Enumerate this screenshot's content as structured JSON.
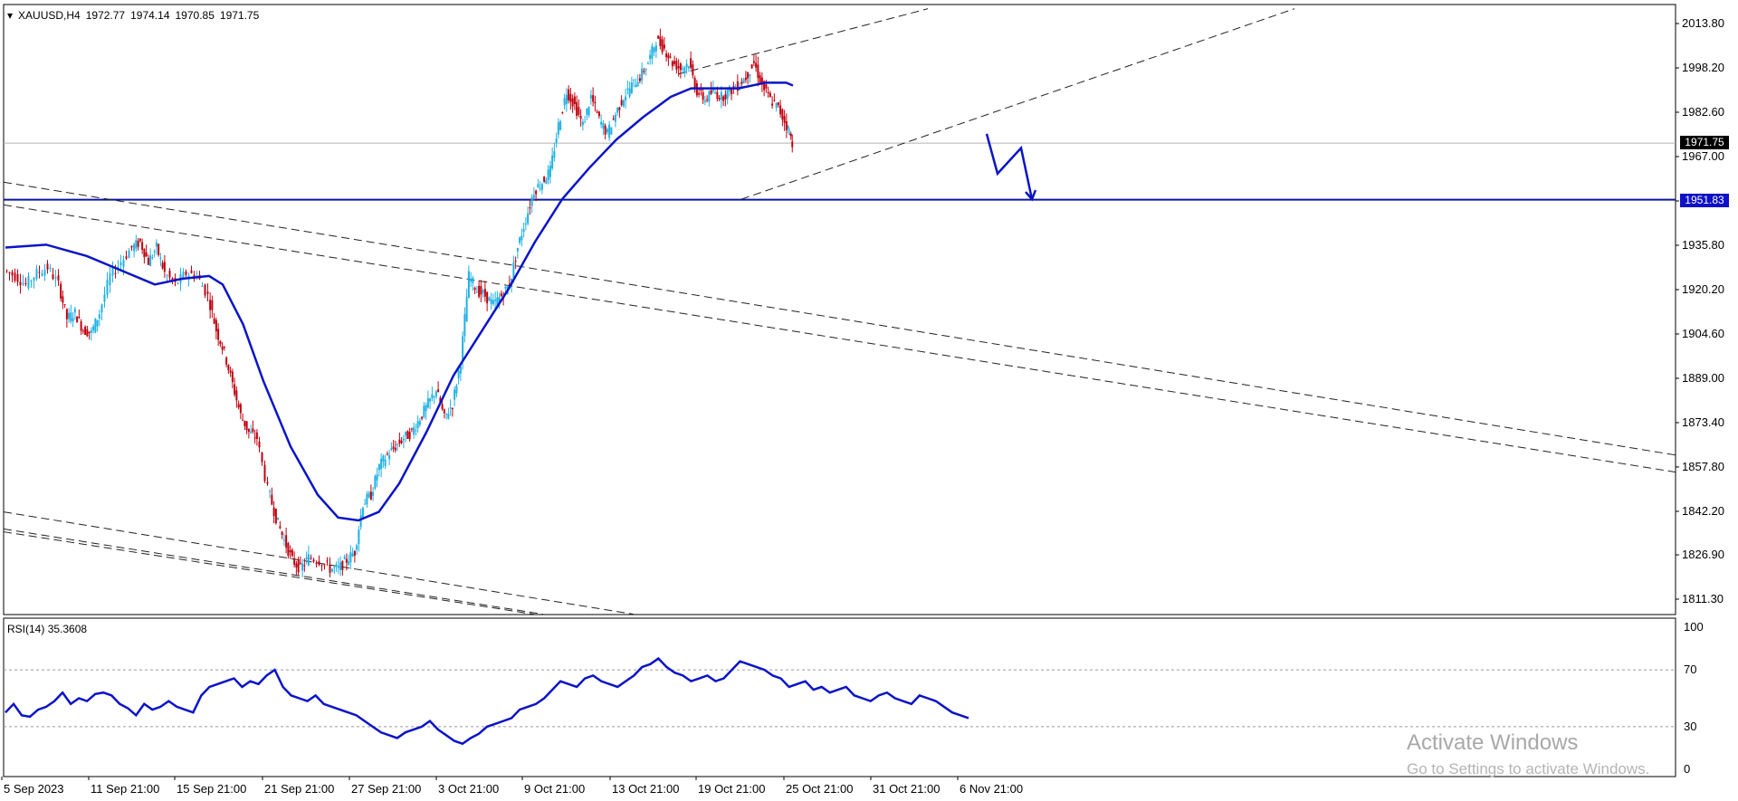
{
  "symbol_header": {
    "symbol": "XAUUSD,H4",
    "open": "1972.77",
    "high": "1974.14",
    "low": "1970.85",
    "close": "1971.75"
  },
  "rsi_header": {
    "name": "RSI(14)",
    "value": "35.3608"
  },
  "price_tags": {
    "last": "1971.75",
    "level": "1951.83"
  },
  "watermark": {
    "line1": "Activate Windows",
    "line2": "Go to Settings to activate Windows."
  },
  "colors": {
    "bull": "#1fb1e3",
    "bear": "#c0000f",
    "ma": "#0a14c8",
    "rsi": "#0a14c8",
    "level": "#0a14a0"
  },
  "chart_data": [
    {
      "type": "candlestick",
      "title": "XAUUSD,H4",
      "y_ticks": [
        2013.8,
        1998.2,
        1982.6,
        1967.0,
        1951.4,
        1935.8,
        1920.2,
        1904.6,
        1889.0,
        1873.4,
        1857.8,
        1842.2,
        1826.9,
        1811.3
      ],
      "y_tick_labels": [
        "2013.80",
        "1998.20",
        "1982.60",
        "1967.00",
        "1951.40",
        "1935.80",
        "1920.20",
        "1904.60",
        "1889.00",
        "1873.40",
        "1857.80",
        "1842.20",
        "1826.90",
        "1811.30"
      ],
      "x_tick_labels": [
        "5 Sep 2023",
        "11 Sep 21:00",
        "15 Sep 21:00",
        "21 Sep 21:00",
        "27 Sep 21:00",
        "3 Oct 21:00",
        "9 Oct 21:00",
        "13 Oct 21:00",
        "19 Oct 21:00",
        "25 Oct 21:00",
        "31 Oct 21:00",
        "6 Nov 21:00"
      ],
      "ylim": [
        1806,
        2019
      ],
      "last_price": 1971.75,
      "horizontal_level": 1951.83,
      "close_path": [
        [
          0,
          1927
        ],
        [
          8,
          1925
        ],
        [
          16,
          1922
        ],
        [
          24,
          1926
        ],
        [
          32,
          1928
        ],
        [
          40,
          1922
        ],
        [
          46,
          1910
        ],
        [
          52,
          1912
        ],
        [
          58,
          1906
        ],
        [
          64,
          1905
        ],
        [
          70,
          1912
        ],
        [
          78,
          1925
        ],
        [
          86,
          1930
        ],
        [
          94,
          1935
        ],
        [
          100,
          1937
        ],
        [
          106,
          1930
        ],
        [
          112,
          1935
        ],
        [
          118,
          1926
        ],
        [
          126,
          1922
        ],
        [
          134,
          1926
        ],
        [
          142,
          1925
        ],
        [
          150,
          1918
        ],
        [
          156,
          1906
        ],
        [
          162,
          1898
        ],
        [
          168,
          1887
        ],
        [
          174,
          1876
        ],
        [
          180,
          1870
        ],
        [
          186,
          1868
        ],
        [
          194,
          1850
        ],
        [
          200,
          1840
        ],
        [
          206,
          1832
        ],
        [
          212,
          1825
        ],
        [
          218,
          1822
        ],
        [
          224,
          1826
        ],
        [
          232,
          1825
        ],
        [
          240,
          1822
        ],
        [
          246,
          1822
        ],
        [
          252,
          1825
        ],
        [
          258,
          1828
        ],
        [
          264,
          1845
        ],
        [
          270,
          1848
        ],
        [
          276,
          1858
        ],
        [
          282,
          1862
        ],
        [
          288,
          1865
        ],
        [
          294,
          1868
        ],
        [
          300,
          1870
        ],
        [
          306,
          1875
        ],
        [
          312,
          1880
        ],
        [
          318,
          1885
        ],
        [
          324,
          1875
        ],
        [
          330,
          1880
        ],
        [
          336,
          1895
        ],
        [
          342,
          1925
        ],
        [
          348,
          1920
        ],
        [
          354,
          1918
        ],
        [
          360,
          1915
        ],
        [
          366,
          1918
        ],
        [
          372,
          1922
        ],
        [
          378,
          1935
        ],
        [
          384,
          1945
        ],
        [
          390,
          1955
        ],
        [
          396,
          1958
        ],
        [
          402,
          1962
        ],
        [
          408,
          1978
        ],
        [
          414,
          1990
        ],
        [
          420,
          1985
        ],
        [
          426,
          1978
        ],
        [
          432,
          1988
        ],
        [
          438,
          1980
        ],
        [
          444,
          1975
        ],
        [
          450,
          1982
        ],
        [
          456,
          1988
        ],
        [
          462,
          1992
        ],
        [
          468,
          1995
        ],
        [
          474,
          2000
        ],
        [
          480,
          2008
        ],
        [
          486,
          2005
        ],
        [
          492,
          2000
        ],
        [
          498,
          1998
        ],
        [
          504,
          2000
        ],
        [
          510,
          1990
        ],
        [
          516,
          1987
        ],
        [
          522,
          1990
        ],
        [
          528,
          1988
        ],
        [
          534,
          1990
        ],
        [
          540,
          1992
        ],
        [
          546,
          1995
        ],
        [
          552,
          2000
        ],
        [
          558,
          1992
        ],
        [
          564,
          1987
        ],
        [
          570,
          1984
        ],
        [
          576,
          1978
        ],
        [
          580,
          1972
        ]
      ],
      "moving_average": [
        [
          0,
          1935
        ],
        [
          30,
          1936
        ],
        [
          60,
          1932
        ],
        [
          90,
          1926
        ],
        [
          110,
          1922
        ],
        [
          130,
          1924
        ],
        [
          150,
          1925
        ],
        [
          160,
          1922
        ],
        [
          175,
          1908
        ],
        [
          190,
          1888
        ],
        [
          210,
          1865
        ],
        [
          230,
          1848
        ],
        [
          245,
          1840
        ],
        [
          260,
          1839
        ],
        [
          275,
          1842
        ],
        [
          290,
          1852
        ],
        [
          310,
          1870
        ],
        [
          330,
          1890
        ],
        [
          350,
          1905
        ],
        [
          370,
          1920
        ],
        [
          390,
          1937
        ],
        [
          410,
          1952
        ],
        [
          430,
          1963
        ],
        [
          450,
          1973
        ],
        [
          470,
          1981
        ],
        [
          490,
          1988
        ],
        [
          505,
          1991
        ],
        [
          520,
          1991
        ],
        [
          540,
          1991
        ],
        [
          560,
          1993
        ],
        [
          575,
          1993
        ],
        [
          580,
          1992
        ]
      ],
      "trend_lines": [
        {
          "style": "dashed",
          "from": [
            0,
            1958
          ],
          "to": [
            1920,
            1862
          ]
        },
        {
          "style": "dashed",
          "from": [
            0,
            1950
          ],
          "to": [
            1920,
            1856
          ]
        },
        {
          "style": "dashed",
          "from": [
            0,
            1842
          ],
          "to": [
            700,
            1806
          ]
        },
        {
          "style": "dashed",
          "from": [
            0,
            1836
          ],
          "to": [
            600,
            1806
          ]
        },
        {
          "style": "dashed",
          "from": [
            0,
            1835
          ],
          "to": [
            590,
            1806
          ]
        },
        {
          "style": "dashed",
          "from": [
            745,
            1996
          ],
          "to": [
            1025,
            2019
          ]
        },
        {
          "style": "dashed",
          "from": [
            815,
            1952
          ],
          "to": [
            1430,
            2019
          ]
        }
      ],
      "projection_arrow": [
        [
          1090,
          1975
        ],
        [
          1102,
          1961
        ],
        [
          1128,
          1970
        ],
        [
          1140,
          1952
        ]
      ]
    },
    {
      "type": "line",
      "title": "RSI(14) 35.3608",
      "ylim": [
        0,
        100
      ],
      "y_ticks": [
        100,
        70,
        30,
        0
      ],
      "y_tick_labels": [
        "100",
        "70",
        "30",
        "0"
      ],
      "levels": [
        70,
        30
      ],
      "series": [
        {
          "values": [
            40,
            46,
            38,
            37,
            42,
            44,
            48,
            54,
            46,
            50,
            48,
            53,
            54,
            52,
            46,
            43,
            38,
            46,
            42,
            44,
            48,
            44,
            42,
            40,
            52,
            58,
            60,
            62,
            64,
            58,
            62,
            60,
            66,
            70,
            58,
            52,
            50,
            48,
            52,
            46,
            44,
            42,
            40,
            38,
            34,
            30,
            26,
            24,
            22,
            26,
            28,
            30,
            34,
            28,
            24,
            20,
            18,
            22,
            25,
            30,
            32,
            34,
            36,
            42,
            44,
            46,
            50,
            56,
            62,
            60,
            58,
            64,
            66,
            62,
            60,
            58,
            62,
            66,
            72,
            74,
            78,
            72,
            68,
            66,
            62,
            64,
            66,
            62,
            64,
            70,
            76,
            74,
            72,
            70,
            66,
            64,
            58,
            60,
            62,
            56,
            58,
            54,
            56,
            58,
            52,
            50,
            48,
            52,
            54,
            50,
            48,
            46,
            52,
            50,
            48,
            44,
            40,
            38,
            36
          ]
        }
      ]
    }
  ]
}
